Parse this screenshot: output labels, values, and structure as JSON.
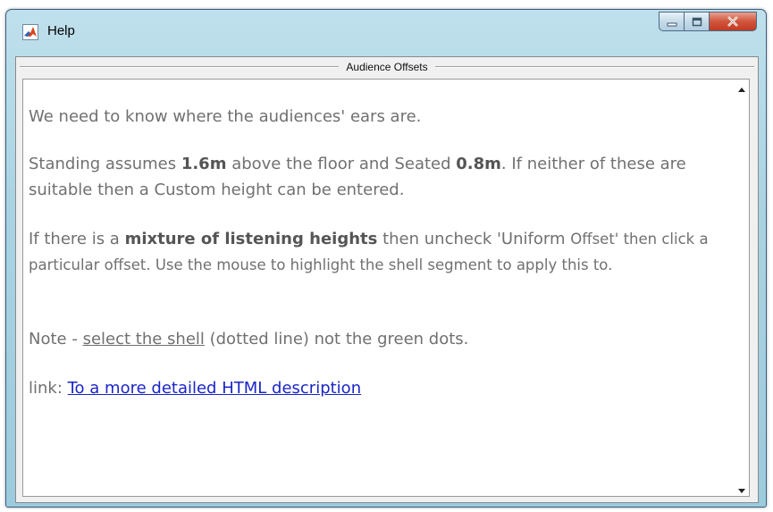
{
  "window": {
    "title": "Help",
    "controls": {
      "minimize": "minimize",
      "maximize": "maximize",
      "close": "close"
    }
  },
  "panel": {
    "title": "Audience Offsets"
  },
  "content": {
    "p1": "We need to know where the audiences' ears are.",
    "p2": {
      "a": "Standing assumes ",
      "b_standing": "1.6m",
      "c": " above the floor and Seated ",
      "d_seated": "0.8m",
      "e": ". If neither of these are suitable then a Custom height can be entered."
    },
    "p3": {
      "a": "If there is a ",
      "b_bold": "mixture of listening heights",
      "c": " then uncheck 'Uniform ",
      "d": "Offset' then click a particular offset.  Use the mouse to highlight the shell segment to apply this to."
    },
    "p4": {
      "a": "Note - ",
      "b_underlined": "select the shell",
      "c": " (dotted line) not the green dots."
    },
    "p5": {
      "a": "link: ",
      "link_text": "To a more detailed HTML description"
    }
  },
  "colors": {
    "text": "#707070",
    "link": "#1a25c8",
    "title_gradient": "#a9d3e2",
    "close_button": "#c23b22"
  }
}
